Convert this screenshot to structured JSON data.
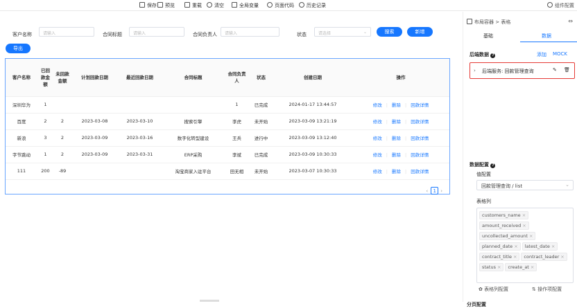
{
  "toolbar": {
    "save": "保存",
    "preview": "预览",
    "reload": "重载",
    "clear": "清空",
    "global_vars": "全局变量",
    "page_code": "页面代码",
    "history": "历史记录",
    "component_config": "组件配置"
  },
  "search": {
    "customer_label": "客户名称",
    "customer_placeholder": "请输入",
    "title_label": "合同标题",
    "title_placeholder": "请输入",
    "leader_label": "合同负责人",
    "leader_placeholder": "请输入",
    "status_label": "状态",
    "status_placeholder": "请选择",
    "search_button": "搜索",
    "add_button": "新增",
    "export_button": "导出"
  },
  "table": {
    "headers": [
      "客户名称",
      "已回款金额",
      "未回款金额",
      "计划回款日期",
      "最近回款日期",
      "合同标题",
      "合同负责人",
      "状态",
      "创建日期",
      "操作"
    ],
    "rows": [
      [
        "深圳华为",
        "1",
        "",
        "",
        "",
        "",
        "1",
        "已完成",
        "2024-01-17 13:44:57"
      ],
      [
        "百度",
        "2",
        "2",
        "2023-03-08",
        "2023-03-10",
        "搜索引擎",
        "李虎",
        "未开始",
        "2023-03-09 13:21:19"
      ],
      [
        "新浪",
        "3",
        "2",
        "2023-03-09",
        "2023-03-16",
        "数字化转型建设",
        "王兵",
        "进行中",
        "2023-03-09 13:12:40"
      ],
      [
        "字节跳动",
        "1",
        "2",
        "2023-03-09",
        "2023-03-31",
        "ERP采购",
        "李斌",
        "已完成",
        "2023-03-09 10:30:33"
      ],
      [
        "111",
        "200",
        "-89",
        "",
        "",
        "淘宝商家入驻平台",
        "田无相",
        "未开始",
        "2023-03-07 10:30:33"
      ]
    ],
    "ops": {
      "edit": "修改",
      "delete": "删除",
      "detail": "回款详情"
    },
    "current_page": "1"
  },
  "side": {
    "breadcrumb": "布局容器 > 表格",
    "tab_basic": "基础",
    "tab_data": "数据",
    "backend_title": "后端数据",
    "add": "添加",
    "mock": "MOCK",
    "service_label": "后端服务: 回款管理查询",
    "data_config_title": "数据配置",
    "value_config": "值配置",
    "value_selected": "回款管理查询 / list",
    "table_columns": "表格列",
    "tags": [
      "customers_name",
      "amount_received",
      "uncollected_amount",
      "planned_date",
      "latest_date",
      "contract_title",
      "contract_leader",
      "status",
      "create_at"
    ],
    "column_config_btn": "表格列配置",
    "op_config_btn": "操作项配置",
    "pagination_config": "分页配置"
  }
}
